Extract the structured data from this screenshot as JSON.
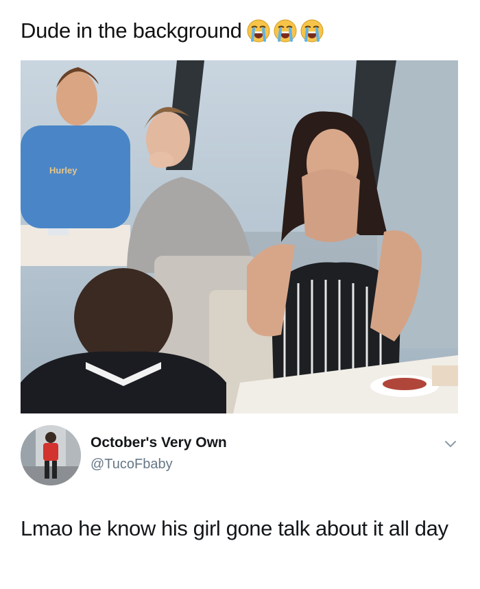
{
  "meme": {
    "caption": "Dude in the background",
    "caption_emojis": [
      "loudly-crying-face-emoji",
      "loudly-crying-face-emoji",
      "loudly-crying-face-emoji"
    ]
  },
  "photo": {
    "shirt_text": "Hurley"
  },
  "tweet": {
    "display_name": "October's Very Own",
    "handle": "@TucoFbaby",
    "text": "Lmao he know his girl gone talk about it all day",
    "menu_icon": "chevron-down-icon"
  },
  "colors": {
    "text": "#14171a",
    "handle": "#657786",
    "emoji_yellow": "#f7c44a",
    "emoji_tears": "#5fb3e8"
  }
}
